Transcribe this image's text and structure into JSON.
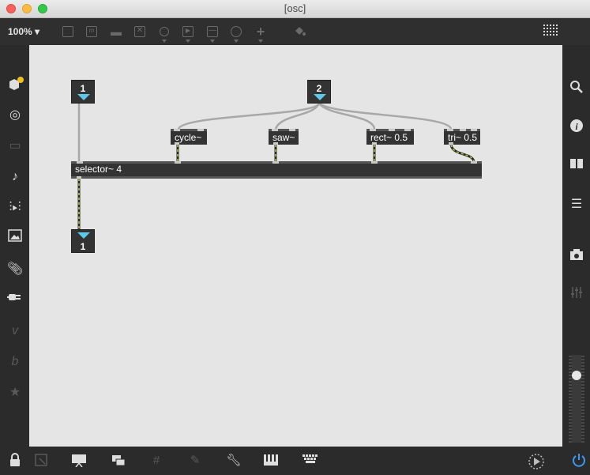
{
  "window": {
    "title": "[osc]"
  },
  "toolbar": {
    "zoom": "100%",
    "icons": [
      "object-box-icon",
      "message-box-icon",
      "comment-icon",
      "toggle-icon",
      "button-icon",
      "play-icon",
      "slider-icon",
      "dial-icon",
      "plus-icon",
      "paint-bucket-icon",
      "grid-icon"
    ]
  },
  "patch": {
    "number_top_left": "1",
    "number_top_right": "2",
    "number_bottom": "1",
    "objects": {
      "cycle": "cycle~",
      "saw": "saw~",
      "rect": "rect~ 0.5",
      "tri": "tri~ 0.5",
      "selector": "selector~ 4"
    }
  },
  "colors": {
    "canvas": "#e5e5e5",
    "object": "#333333",
    "signal_cord": "#b8cc3a",
    "accent_dot": "#f0c020"
  }
}
